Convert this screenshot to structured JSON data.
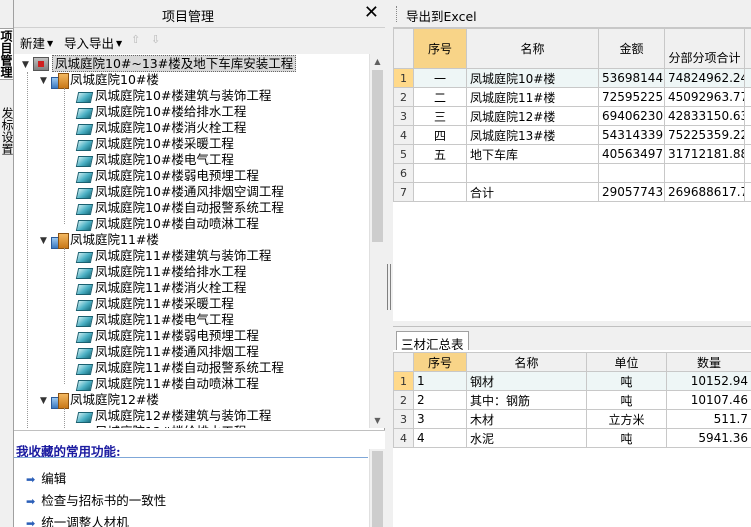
{
  "side_tabs": [
    "项目管理",
    "发标设置"
  ],
  "left_panel": {
    "title": "项目管理",
    "close_icon": "✕",
    "toolbar": {
      "new_label": "新建",
      "import_export_label": "导入导出"
    }
  },
  "tree": {
    "root": "凤城庭院10#~13#楼及地下车库安装工程",
    "groups": [
      {
        "label": "凤城庭院10#楼",
        "items": [
          "凤城庭院10#楼建筑与装饰工程",
          "凤城庭院10#楼给排水工程",
          "凤城庭院10#楼消火栓工程",
          "凤城庭院10#楼采暖工程",
          "凤城庭院10#楼电气工程",
          "凤城庭院10#楼弱电预埋工程",
          "凤城庭院10#楼通风排烟空调工程",
          "凤城庭院10#楼自动报警系统工程",
          "凤城庭院10#楼自动喷淋工程"
        ]
      },
      {
        "label": "凤城庭院11#楼",
        "items": [
          "凤城庭院11#楼建筑与装饰工程",
          "凤城庭院11#楼给排水工程",
          "凤城庭院11#楼消火栓工程",
          "凤城庭院11#楼采暖工程",
          "凤城庭院11#楼电气工程",
          "凤城庭院11#楼弱电预埋工程",
          "凤城庭院11#楼通风排烟工程",
          "凤城庭院11#楼自动报警系统工程",
          "凤城庭院11#楼自动喷淋工程"
        ]
      },
      {
        "label": "凤城庭院12#楼",
        "items": [
          "凤城庭院12#楼建筑与装饰工程",
          "凤城庭院12#楼给排水工程"
        ]
      }
    ]
  },
  "favorites": {
    "title": "我收藏的常用功能:",
    "items": [
      "编辑",
      "检查与招标书的一致性",
      "统一调整人材机"
    ]
  },
  "right_toolbar": {
    "export_label": "导出到Excel"
  },
  "summary_table": {
    "headers": [
      "序号",
      "名称",
      "金额",
      "分部分项合计"
    ],
    "rows": [
      {
        "rownum": "1",
        "seq": "一",
        "name": "凤城庭院10#楼",
        "amount": "53698144",
        "subtotal": "74824962.24"
      },
      {
        "rownum": "2",
        "seq": "二",
        "name": "凤城庭院11#楼",
        "amount": "72595225.9",
        "subtotal": "45092963.77"
      },
      {
        "rownum": "3",
        "seq": "三",
        "name": "凤城庭院12#楼",
        "amount": "69406230.7",
        "subtotal": "42833150.63"
      },
      {
        "rownum": "4",
        "seq": "四",
        "name": "凤城庭院13#楼",
        "amount": "54314339.7",
        "subtotal": "75225359.22"
      },
      {
        "rownum": "5",
        "seq": "五",
        "name": "地下车库",
        "amount": "40563497.0",
        "subtotal": "31712181.88"
      },
      {
        "rownum": "6",
        "seq": "",
        "name": "",
        "amount": "",
        "subtotal": ""
      },
      {
        "rownum": "7",
        "seq": "",
        "name": "合计",
        "amount": "290577437.",
        "subtotal": "269688617.74"
      }
    ]
  },
  "materials_tab": {
    "label": "三材汇总表"
  },
  "materials_table": {
    "headers": [
      "序号",
      "名称",
      "单位",
      "数量"
    ],
    "rows": [
      {
        "rownum": "1",
        "seq": "1",
        "name": "钢材",
        "unit": "吨",
        "qty": "10152.94"
      },
      {
        "rownum": "2",
        "seq": "2",
        "name": "其中：钢筋",
        "unit": "吨",
        "qty": "10107.46"
      },
      {
        "rownum": "3",
        "seq": "3",
        "name": "木材",
        "unit": "立方米",
        "qty": "511.7"
      },
      {
        "rownum": "4",
        "seq": "4",
        "name": "水泥",
        "unit": "吨",
        "qty": "5941.36"
      }
    ]
  }
}
